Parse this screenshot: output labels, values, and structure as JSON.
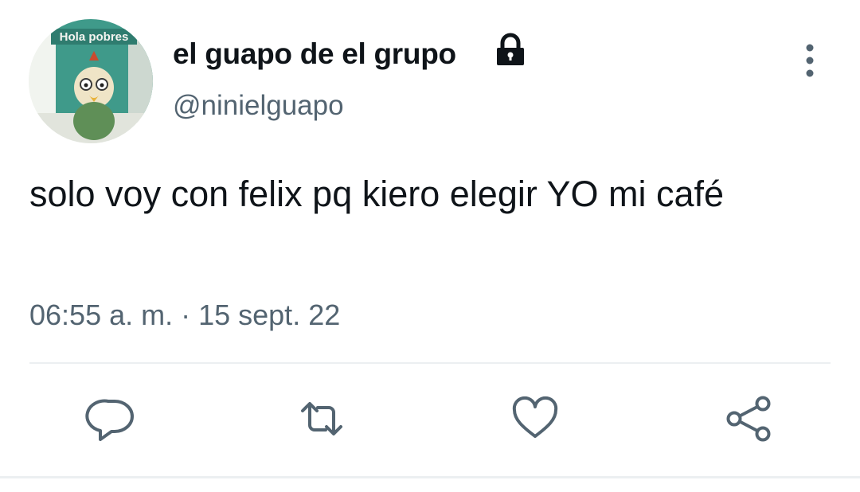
{
  "tweet": {
    "avatar_caption": "Hola pobres",
    "display_name": "el guapo de el grupo",
    "handle": "@ninielguapo",
    "text": "solo voy con felix pq kiero elegir YO mi café",
    "timestamp": "06:55 a. m. · 15 sept. 22",
    "protected_icon": "lock-icon"
  },
  "actions": [
    {
      "name": "reply",
      "icon": "speech-bubble-icon"
    },
    {
      "name": "retweet",
      "icon": "retweet-arrows-icon"
    },
    {
      "name": "like",
      "icon": "heart-icon"
    },
    {
      "name": "share",
      "icon": "share-nodes-icon"
    }
  ],
  "menu": {
    "icon": "vertical-ellipsis-icon"
  },
  "colors": {
    "text_primary": "#0f1419",
    "text_secondary": "#536471",
    "icon": "#536471",
    "divider": "#eceff1"
  }
}
